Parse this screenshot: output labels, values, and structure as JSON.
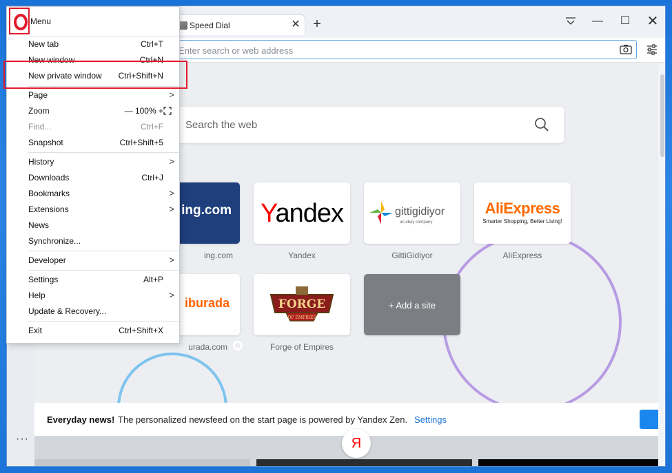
{
  "browser": {
    "tab_title": "Speed Dial",
    "address_placeholder": "Enter search or web address",
    "new_tab_symbol": "+",
    "close_symbol": "✕",
    "win_minimize": "—",
    "win_maximize": "☐",
    "win_close": "✕"
  },
  "page": {
    "search_placeholder": "Search the web",
    "tiles": [
      {
        "label": "Booking.com",
        "visible_label": "ing.com",
        "logo_text": "ing.com"
      },
      {
        "label": "Yandex",
        "logo_text": "Yandex"
      },
      {
        "label": "GittiGidiyor",
        "logo_text": "gittigidiyor",
        "logo_sub": "an ebay company"
      },
      {
        "label": "AliExpress",
        "logo_text": "AliExpress",
        "logo_sub": "Smarter Shopping, Better Living!"
      },
      {
        "label": "Hepsiburada",
        "visible_label": "urada.com",
        "logo_text": "iburada"
      },
      {
        "label": "Forge of Empires",
        "logo_text": "FORGE",
        "logo_sub": "OF EMPIRES"
      },
      {
        "label": "+ Add a site"
      }
    ],
    "news": {
      "bold": "Everyday news!",
      "text": "The personalized newsfeed on the start page is powered by Yandex Zen.",
      "link": "Settings"
    },
    "yandex_button": "Я",
    "sidebar_more": "···"
  },
  "menu": {
    "title": "Menu",
    "items": [
      {
        "label": "New tab",
        "shortcut": "Ctrl+T"
      },
      {
        "label": "New window",
        "shortcut": "Ctrl+N"
      },
      {
        "label": "New private window",
        "shortcut": "Ctrl+Shift+N"
      },
      {
        "label": "Page",
        "arrow": ">"
      },
      {
        "label": "Zoom",
        "zoom": "—  100% +"
      },
      {
        "label": "Find...",
        "shortcut": "Ctrl+F",
        "disabled": true
      },
      {
        "label": "Snapshot",
        "shortcut": "Ctrl+Shift+5"
      },
      {
        "label": "History",
        "arrow": ">"
      },
      {
        "label": "Downloads",
        "shortcut": "Ctrl+J"
      },
      {
        "label": "Bookmarks",
        "arrow": ">"
      },
      {
        "label": "Extensions",
        "arrow": ">"
      },
      {
        "label": "News"
      },
      {
        "label": "Synchronize..."
      },
      {
        "label": "Developer",
        "arrow": ">"
      },
      {
        "label": "Settings",
        "shortcut": "Alt+P"
      },
      {
        "label": "Help",
        "arrow": ">"
      },
      {
        "label": "Update & Recovery..."
      },
      {
        "label": "Exit",
        "shortcut": "Ctrl+Shift+X"
      }
    ]
  },
  "colors": {
    "highlight": "#e2192b",
    "link": "#1a73d9",
    "opera_red": "#e2192b"
  }
}
